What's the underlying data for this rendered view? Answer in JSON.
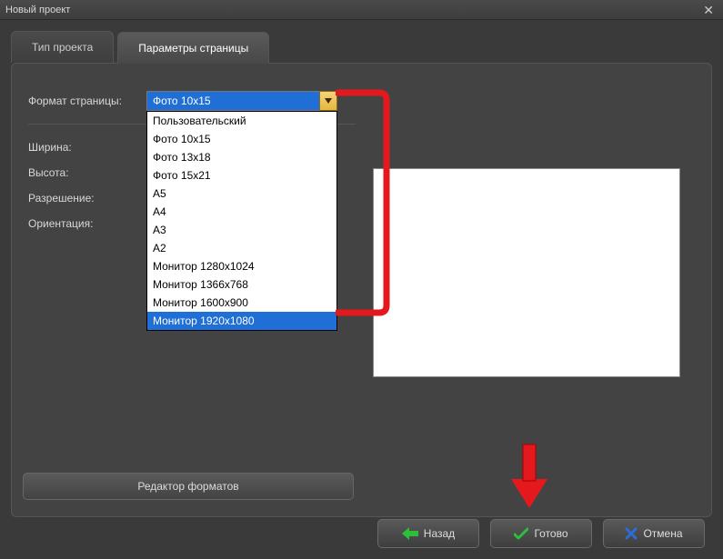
{
  "window": {
    "title": "Новый проект"
  },
  "tabs": {
    "project_type": "Тип проекта",
    "page_params": "Параметры страницы"
  },
  "labels": {
    "page_format": "Формат страницы:",
    "width": "Ширина:",
    "height": "Высота:",
    "resolution": "Разрешение:",
    "orientation": "Ориентация:"
  },
  "combo": {
    "selected": "Фото 10x15",
    "options": [
      "Пользовательский",
      "Фото 10x15",
      "Фото 13x18",
      "Фото 15x21",
      "A5",
      "A4",
      "A3",
      "A2",
      "Монитор 1280x1024",
      "Монитор 1366x768",
      "Монитор 1600x900",
      "Монитор 1920x1080"
    ],
    "highlighted_index": 11
  },
  "buttons": {
    "format_editor": "Редактор форматов",
    "back": "Назад",
    "done": "Готово",
    "cancel": "Отмена"
  }
}
